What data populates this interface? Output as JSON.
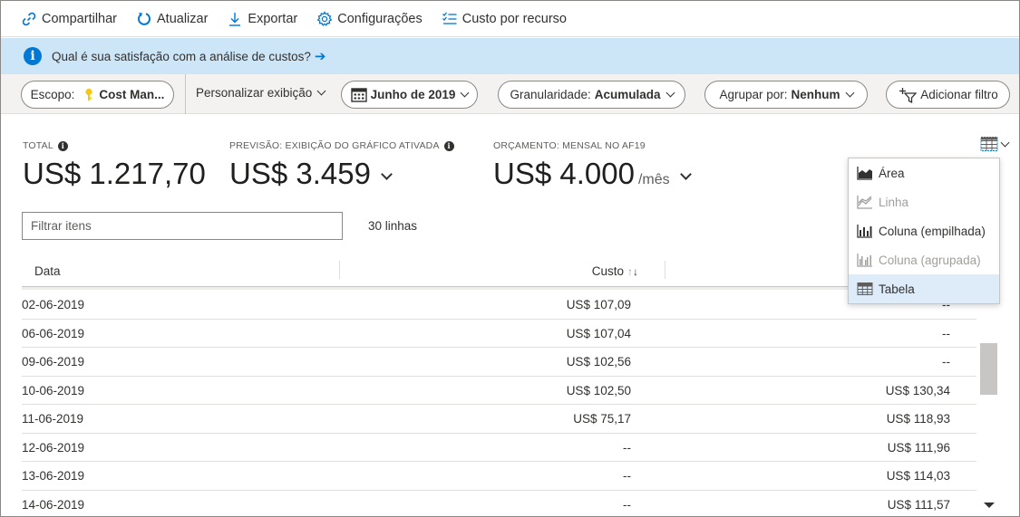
{
  "toolbar": {
    "share": "Compartilhar",
    "refresh": "Atualizar",
    "export": "Exportar",
    "settings": "Configurações",
    "cost_by_resource": "Custo por recurso"
  },
  "banner": {
    "text": "Qual é sua satisfação com a análise de custos?"
  },
  "filters": {
    "scope_label": "Escopo:",
    "scope_value": "Cost Man...",
    "customize": "Personalizar exibição",
    "date_range": "Junho de 2019",
    "granularity_label": "Granularidade:",
    "granularity_value": "Acumulada",
    "group_by_label": "Agrupar por:",
    "group_by_value": "Nenhum",
    "add_filter": "Adicionar filtro"
  },
  "kpis": {
    "total_label": "TOTAL",
    "total_value": "US$ 1.217,70",
    "forecast_label": "PREVISÃO: EXIBIÇÃO DO GRÁFICO ATIVADA",
    "forecast_value": "US$ 3.459",
    "budget_label": "ORÇAMENTO: MENSAL NO AF19",
    "budget_value": "US$ 4.000",
    "budget_unit": "/mês"
  },
  "search": {
    "placeholder": "Filtrar itens",
    "row_count": "30 linhas"
  },
  "table": {
    "col_date": "Data",
    "col_cost": "Custo",
    "rows": [
      {
        "date": "02-06-2019",
        "cost": "US$ 107,09",
        "budget": "--"
      },
      {
        "date": "06-06-2019",
        "cost": "US$ 107,04",
        "budget": "--"
      },
      {
        "date": "09-06-2019",
        "cost": "US$ 102,56",
        "budget": "--"
      },
      {
        "date": "10-06-2019",
        "cost": "US$ 102,50",
        "budget": "US$ 130,34"
      },
      {
        "date": "11-06-2019",
        "cost": "US$ 75,17",
        "budget": "US$ 118,93"
      },
      {
        "date": "12-06-2019",
        "cost": "--",
        "budget": "US$ 111,96"
      },
      {
        "date": "13-06-2019",
        "cost": "--",
        "budget": "US$ 114,03"
      },
      {
        "date": "14-06-2019",
        "cost": "--",
        "budget": "US$ 111,57"
      }
    ]
  },
  "view_menu": {
    "items": [
      {
        "label": "Área",
        "icon": "area-chart-icon",
        "disabled": false,
        "selected": false
      },
      {
        "label": "Linha",
        "icon": "line-chart-icon",
        "disabled": true,
        "selected": false
      },
      {
        "label": "Coluna (empilhada)",
        "icon": "stacked-column-chart-icon",
        "disabled": false,
        "selected": false
      },
      {
        "label": "Coluna (agrupada)",
        "icon": "grouped-column-chart-icon",
        "disabled": true,
        "selected": false
      },
      {
        "label": "Tabela",
        "icon": "table-icon",
        "disabled": false,
        "selected": true
      }
    ]
  },
  "colors": {
    "accent": "#0078d4",
    "banner_bg": "#cde6f7",
    "filter_bar_bg": "#f3f2f1",
    "selected_item_bg": "#deecf9"
  }
}
